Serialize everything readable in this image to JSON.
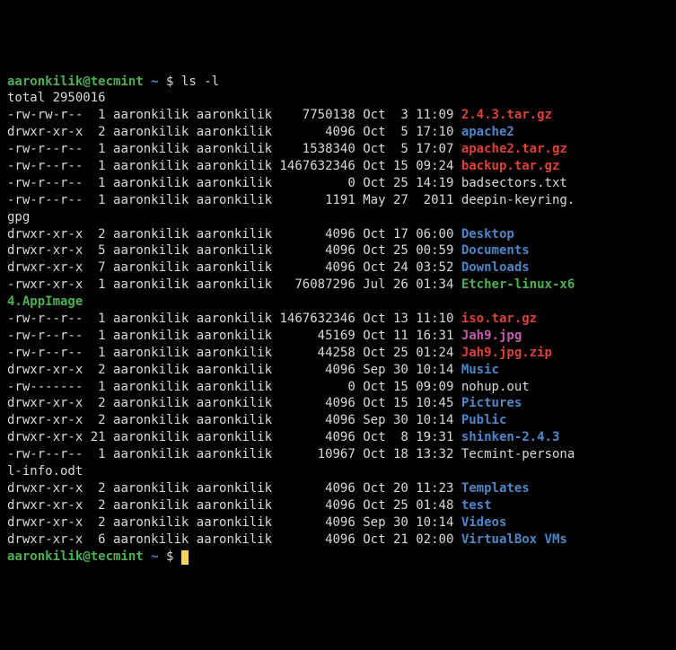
{
  "prompt": {
    "user_host": "aaronkilik@tecmint",
    "tilde": "~",
    "dollar": "$",
    "command": "ls -l"
  },
  "total": "total 2950016",
  "rows": [
    {
      "perm": "-rw-rw-r--",
      "links": " 1",
      "owner": "aaronkilik",
      "group": "aaronkilik",
      "size": "   7750138",
      "date": "Oct  3 11:09",
      "name": "2.4.3.tar.gz",
      "cls": "f-red"
    },
    {
      "perm": "drwxr-xr-x",
      "links": " 2",
      "owner": "aaronkilik",
      "group": "aaronkilik",
      "size": "      4096",
      "date": "Oct  5 17:10",
      "name": "apache2",
      "cls": "f-blue"
    },
    {
      "perm": "-rw-r--r--",
      "links": " 1",
      "owner": "aaronkilik",
      "group": "aaronkilik",
      "size": "   1538340",
      "date": "Oct  5 17:07",
      "name": "apache2.tar.gz",
      "cls": "f-red"
    },
    {
      "perm": "-rw-r--r--",
      "links": " 1",
      "owner": "aaronkilik",
      "group": "aaronkilik",
      "size": "1467632346",
      "date": "Oct 15 09:24",
      "name": "backup.tar.gz",
      "cls": "f-red"
    },
    {
      "perm": "-rw-r--r--",
      "links": " 1",
      "owner": "aaronkilik",
      "group": "aaronkilik",
      "size": "         0",
      "date": "Oct 25 14:19",
      "name": "badsectors.txt",
      "cls": "f-white"
    },
    {
      "perm": "-rw-r--r--",
      "links": " 1",
      "owner": "aaronkilik",
      "group": "aaronkilik",
      "size": "      1191",
      "date": "May 27  2011",
      "name": "deepin-keyring.",
      "cls": "f-white",
      "wrap": "gpg"
    },
    {
      "perm": "drwxr-xr-x",
      "links": " 2",
      "owner": "aaronkilik",
      "group": "aaronkilik",
      "size": "      4096",
      "date": "Oct 17 06:00",
      "name": "Desktop",
      "cls": "f-blue"
    },
    {
      "perm": "drwxr-xr-x",
      "links": " 5",
      "owner": "aaronkilik",
      "group": "aaronkilik",
      "size": "      4096",
      "date": "Oct 25 00:59",
      "name": "Documents",
      "cls": "f-blue"
    },
    {
      "perm": "drwxr-xr-x",
      "links": " 7",
      "owner": "aaronkilik",
      "group": "aaronkilik",
      "size": "      4096",
      "date": "Oct 24 03:52",
      "name": "Downloads",
      "cls": "f-blue"
    },
    {
      "perm": "-rwxr-xr-x",
      "links": " 1",
      "owner": "aaronkilik",
      "group": "aaronkilik",
      "size": "  76087296",
      "date": "Jul 26 01:34",
      "name": "Etcher-linux-x6",
      "cls": "f-green",
      "wrap": "4.AppImage",
      "wrapCls": "f-green"
    },
    {
      "perm": "-rw-r--r--",
      "links": " 1",
      "owner": "aaronkilik",
      "group": "aaronkilik",
      "size": "1467632346",
      "date": "Oct 13 11:10",
      "name": "iso.tar.gz",
      "cls": "f-red"
    },
    {
      "perm": "-rw-r--r--",
      "links": " 1",
      "owner": "aaronkilik",
      "group": "aaronkilik",
      "size": "     45169",
      "date": "Oct 11 16:31",
      "name": "Jah9.jpg",
      "cls": "f-magenta"
    },
    {
      "perm": "-rw-r--r--",
      "links": " 1",
      "owner": "aaronkilik",
      "group": "aaronkilik",
      "size": "     44258",
      "date": "Oct 25 01:24",
      "name": "Jah9.jpg.zip",
      "cls": "f-red"
    },
    {
      "perm": "drwxr-xr-x",
      "links": " 2",
      "owner": "aaronkilik",
      "group": "aaronkilik",
      "size": "      4096",
      "date": "Sep 30 10:14",
      "name": "Music",
      "cls": "f-blue"
    },
    {
      "perm": "-rw-------",
      "links": " 1",
      "owner": "aaronkilik",
      "group": "aaronkilik",
      "size": "         0",
      "date": "Oct 15 09:09",
      "name": "nohup.out",
      "cls": "f-white"
    },
    {
      "perm": "drwxr-xr-x",
      "links": " 2",
      "owner": "aaronkilik",
      "group": "aaronkilik",
      "size": "      4096",
      "date": "Oct 15 10:45",
      "name": "Pictures",
      "cls": "f-blue"
    },
    {
      "perm": "drwxr-xr-x",
      "links": " 2",
      "owner": "aaronkilik",
      "group": "aaronkilik",
      "size": "      4096",
      "date": "Sep 30 10:14",
      "name": "Public",
      "cls": "f-blue"
    },
    {
      "perm": "drwxr-xr-x",
      "links": "21",
      "owner": "aaronkilik",
      "group": "aaronkilik",
      "size": "      4096",
      "date": "Oct  8 19:31",
      "name": "shinken-2.4.3",
      "cls": "f-blue"
    },
    {
      "perm": "-rw-r--r--",
      "links": " 1",
      "owner": "aaronkilik",
      "group": "aaronkilik",
      "size": "     10967",
      "date": "Oct 18 13:32",
      "name": "Tecmint-persona",
      "cls": "f-white",
      "wrap": "l-info.odt"
    },
    {
      "perm": "drwxr-xr-x",
      "links": " 2",
      "owner": "aaronkilik",
      "group": "aaronkilik",
      "size": "      4096",
      "date": "Oct 20 11:23",
      "name": "Templates",
      "cls": "f-blue"
    },
    {
      "perm": "drwxr-xr-x",
      "links": " 2",
      "owner": "aaronkilik",
      "group": "aaronkilik",
      "size": "      4096",
      "date": "Oct 25 01:48",
      "name": "test",
      "cls": "f-blue"
    },
    {
      "perm": "drwxr-xr-x",
      "links": " 2",
      "owner": "aaronkilik",
      "group": "aaronkilik",
      "size": "      4096",
      "date": "Sep 30 10:14",
      "name": "Videos",
      "cls": "f-blue"
    },
    {
      "perm": "drwxr-xr-x",
      "links": " 6",
      "owner": "aaronkilik",
      "group": "aaronkilik",
      "size": "      4096",
      "date": "Oct 21 02:00",
      "name": "VirtualBox VMs",
      "cls": "f-blue"
    }
  ]
}
